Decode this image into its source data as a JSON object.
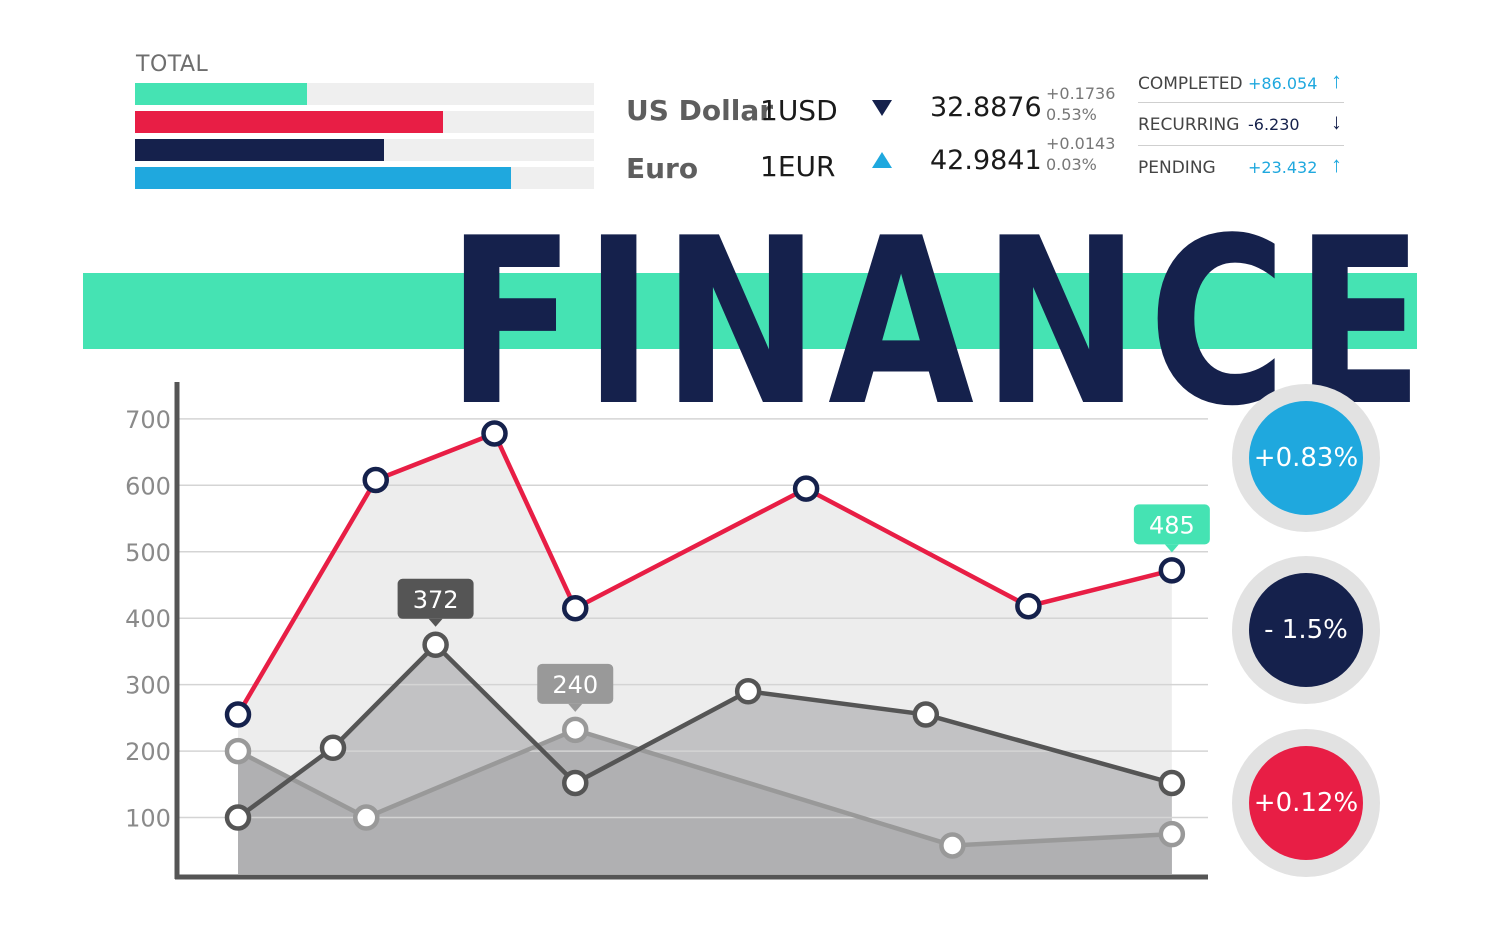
{
  "total": {
    "label": "TOTAL",
    "bars": [
      {
        "fraction": 0.375,
        "color": "#45e3b3"
      },
      {
        "fraction": 0.67,
        "color": "#e81e45"
      },
      {
        "fraction": 0.543,
        "color": "#15214c"
      },
      {
        "fraction": 0.82,
        "color": "#1fa8de"
      }
    ]
  },
  "currencies": [
    {
      "name": "US Dollar",
      "code": "1USD",
      "direction": "down",
      "value": "32.8876",
      "change": "+0.1736",
      "percent": "0.53%"
    },
    {
      "name": "Euro",
      "code": "1EUR",
      "direction": "up",
      "value": "42.9841",
      "change": "+0.0143",
      "percent": "0.03%"
    }
  ],
  "stats": [
    {
      "label": "COMPLETED",
      "value": "+86.054",
      "arrow": "↑",
      "color": "#1fa8de"
    },
    {
      "label": "RECURRING",
      "value": "-6.230",
      "arrow": "↓",
      "color": "#15214c"
    },
    {
      "label": "PENDING",
      "value": "+23.432",
      "arrow": "↑",
      "color": "#1fa8de"
    }
  ],
  "title": "FINANCE",
  "colors": {
    "navy": "#15214c",
    "red": "#e81e45",
    "mint": "#45e3b3",
    "blue": "#1fa8de",
    "darkgray": "#555555",
    "midgray": "#999999"
  },
  "chart_data": {
    "type": "line",
    "ylim": [
      0,
      700
    ],
    "yticks": [
      100,
      200,
      300,
      400,
      500,
      600,
      700
    ],
    "grid": true,
    "series": [
      {
        "color": "#e81e45",
        "marker": "#15214c",
        "fill": "#ededed",
        "points": [
          [
            0,
            255
          ],
          [
            1.45,
            608
          ],
          [
            2.7,
            678
          ],
          [
            3.55,
            415
          ],
          [
            5.98,
            595
          ],
          [
            8.32,
            418
          ],
          [
            9.83,
            472
          ]
        ]
      },
      {
        "color": "#555555",
        "marker": "#555555",
        "fill": "#c2c2c4",
        "points": [
          [
            0,
            100
          ],
          [
            1.0,
            205
          ],
          [
            2.08,
            360
          ],
          [
            3.55,
            152
          ],
          [
            5.37,
            290
          ],
          [
            7.24,
            255
          ],
          [
            9.83,
            152
          ]
        ]
      },
      {
        "color": "#999999",
        "marker": "#999999",
        "fill": "#b0b0b2",
        "points": [
          [
            0,
            200
          ],
          [
            1.35,
            100
          ],
          [
            3.55,
            232
          ],
          [
            7.52,
            58
          ],
          [
            9.83,
            75
          ]
        ]
      }
    ],
    "annotations": [
      {
        "text": "372",
        "series": 1,
        "point": 2,
        "color": "#555555"
      },
      {
        "text": "240",
        "series": 2,
        "point": 2,
        "color": "#999999"
      },
      {
        "text": "485",
        "series": 0,
        "point": 6,
        "color": "#45e3b3"
      }
    ]
  },
  "indicators": [
    {
      "text": "+0.83%",
      "color": "#1fa8de"
    },
    {
      "text": "- 1.5%",
      "color": "#15214c"
    },
    {
      "text": "+0.12%",
      "color": "#e81e45"
    }
  ]
}
